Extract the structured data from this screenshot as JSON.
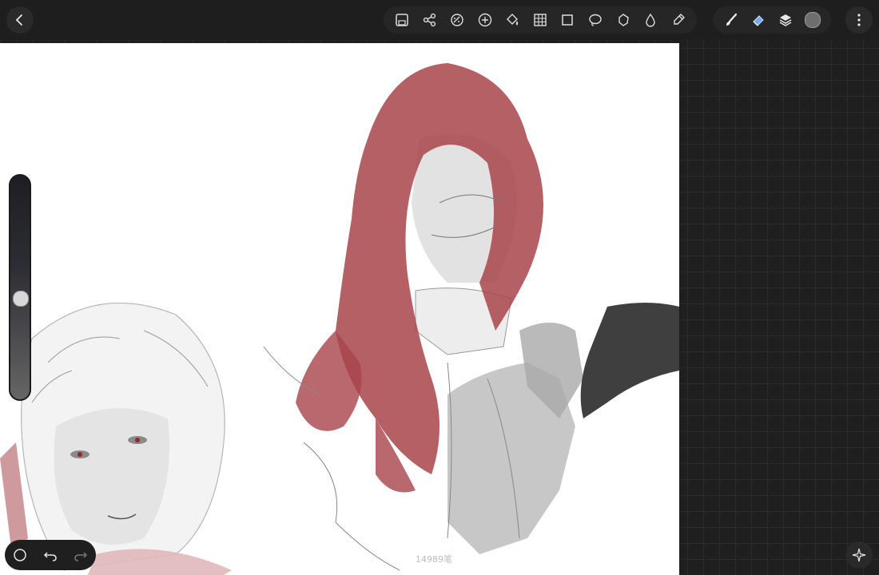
{
  "app": {
    "stroke_count": "14989笔",
    "current_color": "#6e6e6e"
  },
  "topbar": {
    "back_icon": "chevron-left-icon",
    "tools": [
      {
        "name": "save-icon"
      },
      {
        "name": "share-icon"
      },
      {
        "name": "adjustments-icon"
      },
      {
        "name": "add-icon"
      },
      {
        "name": "fill-icon"
      },
      {
        "name": "grid-icon"
      },
      {
        "name": "transform-icon"
      },
      {
        "name": "lasso-icon"
      },
      {
        "name": "shape-icon"
      },
      {
        "name": "smudge-icon"
      },
      {
        "name": "eyedropper-icon"
      }
    ],
    "brush_tools": [
      {
        "name": "brush-icon"
      },
      {
        "name": "eraser-icon",
        "active": true
      },
      {
        "name": "layers-icon"
      },
      {
        "name": "color-swatch"
      }
    ],
    "more_icon": "more-vertical-icon"
  },
  "sidebar": {
    "brush_size_level": 0.55
  },
  "bottom": {
    "modifier_icon": "circle-icon",
    "undo_icon": "undo-icon",
    "redo_icon": "redo-icon",
    "fullscreen_icon": "sparkle-icon"
  },
  "colors": {
    "hair": "#a8444a",
    "accent_eraser": "#7aa7e8"
  }
}
